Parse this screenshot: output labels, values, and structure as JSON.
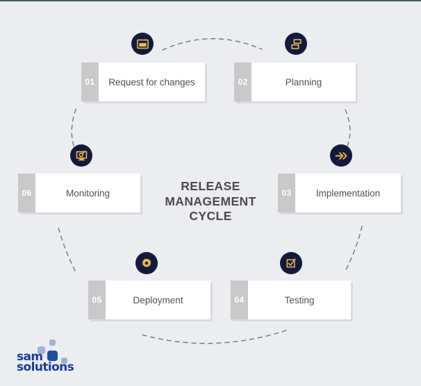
{
  "page": {
    "background_color": "#ebedf1",
    "top_rule_color": "#3e6350",
    "accent_navy": "#121a3e",
    "accent_gold": "#f0b94a",
    "number_tab_color": "#c9c9c9",
    "card_color": "#ffffff",
    "text_color": "#4f5056"
  },
  "center_title": {
    "line1": "RELEASE",
    "line2": "MANAGEMENT",
    "line3": "CYCLE",
    "full": "RELEASE MANAGEMENT CYCLE"
  },
  "steps": [
    {
      "number": "01",
      "label": "Request for changes",
      "icon": "window-icon"
    },
    {
      "number": "02",
      "label": "Planning",
      "icon": "layout-blocks-icon"
    },
    {
      "number": "03",
      "label": "Implementation",
      "icon": "double-arrow-right-icon"
    },
    {
      "number": "04",
      "label": "Testing",
      "icon": "checklist-check-icon"
    },
    {
      "number": "05",
      "label": "Deployment",
      "icon": "gear-icon"
    },
    {
      "number": "06",
      "label": "Monitoring",
      "icon": "monitor-search-icon"
    }
  ],
  "logo": {
    "line1": "sam",
    "line2": "solutions",
    "alt": "sam solutions logo"
  }
}
